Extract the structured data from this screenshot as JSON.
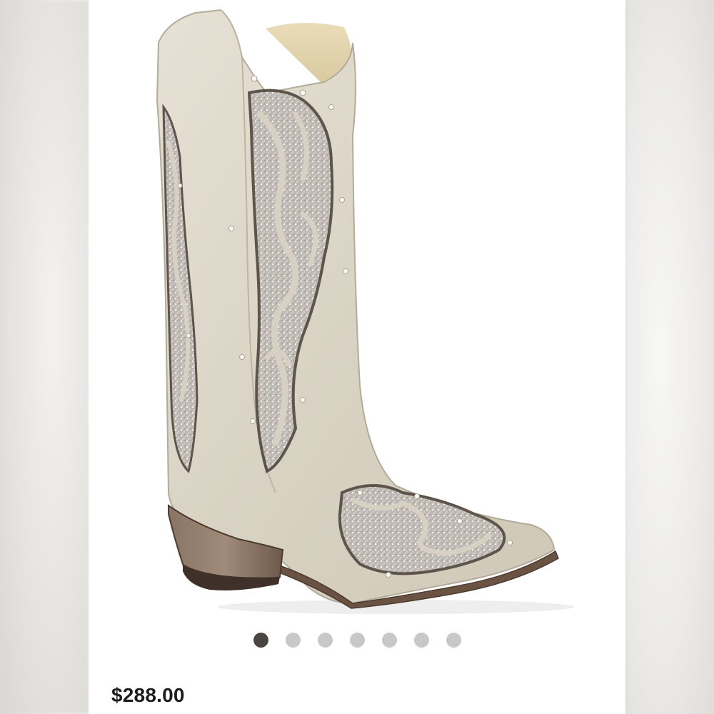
{
  "listing": {
    "price": "$288.00",
    "image_icon": "cowboy-boot-photo",
    "carousel": {
      "count": 7,
      "active_index": 0
    }
  },
  "colors": {
    "accent_mark": "#e02424",
    "dot_active": "#4a4543",
    "dot_inactive": "#c8c8c8"
  }
}
